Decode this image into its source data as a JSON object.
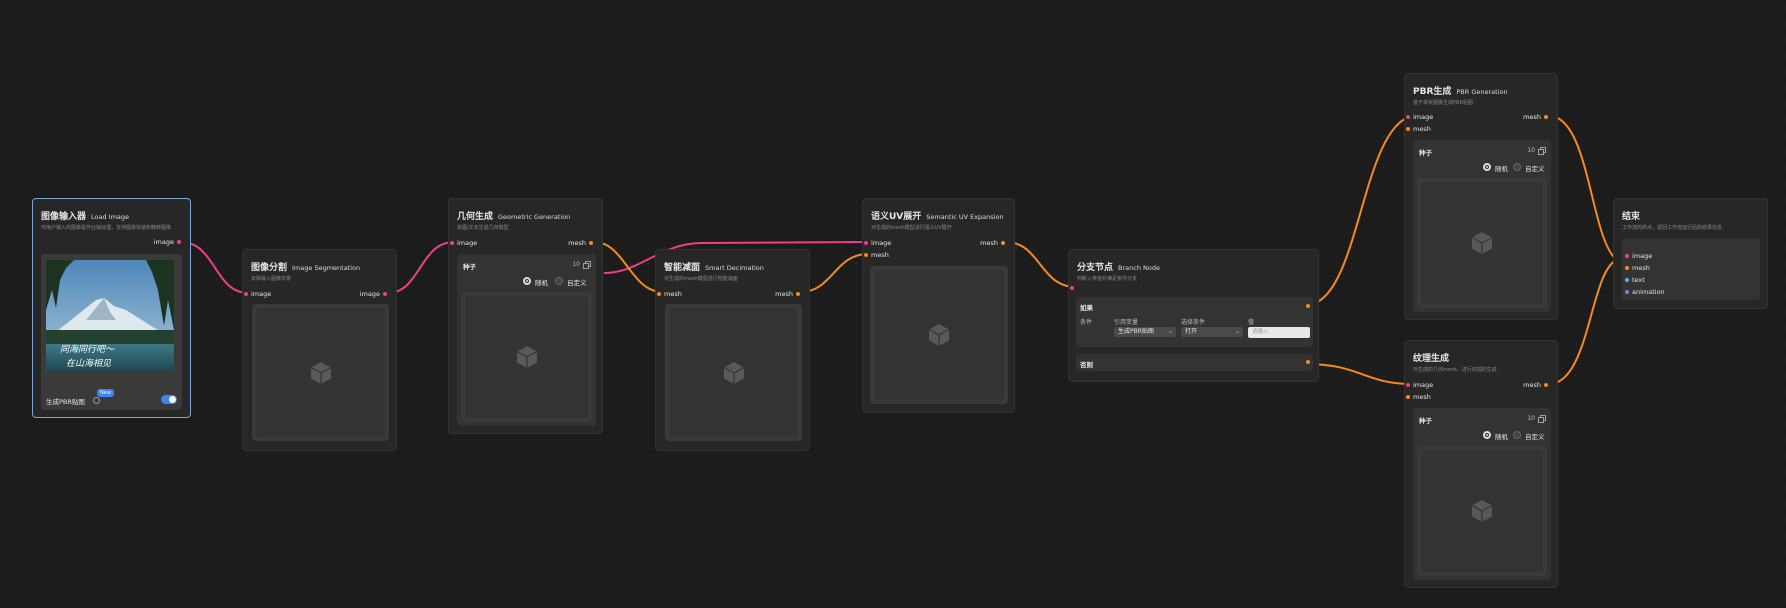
{
  "nodes": {
    "load_image": {
      "title": "图像输入器",
      "title_en": "Load Image",
      "desc": "可用户输入的图像是作业输处理，支持图像快速和精转图像",
      "out_label": "image",
      "photo_caption_1": "同海同行吧～",
      "photo_caption_2": "在山海相见",
      "toggle_label": "生成PBR贴图",
      "badge": "New",
      "toggle_on": true
    },
    "segmentation": {
      "title": "图像分割",
      "title_en": "Image Segmentation",
      "desc": "去除输入图像背景",
      "in_label": "image",
      "out_label": "image"
    },
    "geometric": {
      "title": "几何生成",
      "title_en": "Geometric Generation",
      "desc": "单图/文本生成几何模型",
      "in_label": "image",
      "out_label": "mesh",
      "seed_label": "种子",
      "seed_value": "10",
      "random_label": "随机",
      "custom_label": "自定义"
    },
    "decimation": {
      "title": "智能减面",
      "title_en": "Smart Decimation",
      "desc": "对生成的mesh模型进行智能减面",
      "in_label": "mesh",
      "out_label": "mesh"
    },
    "uv": {
      "title": "语义UV展开",
      "title_en": "Semantic UV Expansion",
      "desc": "对生成的mesh模型进行语义UV展开",
      "in_image": "image",
      "in_mesh": "mesh",
      "out_label": "mesh"
    },
    "branch": {
      "title": "分支节点",
      "title_en": "Branch Node",
      "desc": "判断入参值并满足条件分支",
      "if_label": "如果",
      "cond_label": "条件",
      "ref_var_label": "引用变量",
      "ref_var_value": "生成PBR贴图",
      "select_cond_label": "选择条件",
      "select_cond_value": "打开",
      "value_label": "值",
      "value_placeholder": "请输入",
      "else_label": "否则"
    },
    "pbr": {
      "title": "PBR生成",
      "title_en": "PBR Generation",
      "desc": "基于单张图像生成PBR贴图",
      "in_image": "image",
      "in_mesh": "mesh",
      "out_label": "mesh",
      "seed_label": "种子",
      "seed_value": "10",
      "random_label": "随机",
      "custom_label": "自定义"
    },
    "texture": {
      "title": "纹理生成",
      "desc": "对生成的几何mesh，进行纹理的生成",
      "in_image": "image",
      "in_mesh": "mesh",
      "out_label": "mesh",
      "seed_label": "种子",
      "seed_value": "10",
      "random_label": "随机",
      "custom_label": "自定义"
    },
    "end": {
      "title": "结束",
      "desc": "工作流的终点，返回工作流运行后的结果信息",
      "outputs": [
        "image",
        "mesh",
        "text",
        "animation"
      ]
    }
  },
  "colors": {
    "canvas_bg": "#1c1c1c",
    "node_bg": "#262726",
    "image_edge": "#ec3f8c",
    "mesh_edge": "#f58a1f",
    "selected_border": "#7aa7d8",
    "toggle_on": "#3d84f0"
  },
  "icons": [
    "cube-placeholder-icon",
    "copy-icon",
    "chevron-down-icon"
  ]
}
